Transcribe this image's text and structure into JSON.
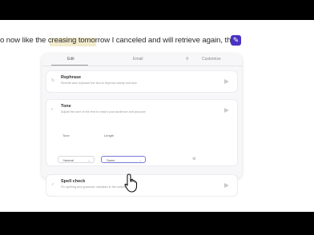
{
  "sentence": {
    "text": "o now like the creasing tomorrow I canceled and will retrieve again, the"
  },
  "tabs": [
    {
      "label": "Edit"
    },
    {
      "label": "Email"
    },
    {
      "label": "Customize"
    }
  ],
  "tools": [
    {
      "name": "Rephrase",
      "description": "Rewrite and rephrase the text to improve clarity and flow"
    },
    {
      "name": "Tone",
      "description": "Adjust the tone of the text to match your audience and purpose"
    },
    {
      "name": "Spell check",
      "description": "Fix spelling and grammar mistakes in the selected text"
    }
  ],
  "options": {
    "tone_label": "Tone",
    "tone_value": "Neutral",
    "length_label": "Length",
    "length_value": "Same"
  },
  "colors": {
    "accent": "#4b32c3",
    "highlight": "#e9dda5"
  },
  "icons": {
    "badge": "pen-icon",
    "send": "send-icon",
    "cursor": "hand-pointer-icon"
  }
}
